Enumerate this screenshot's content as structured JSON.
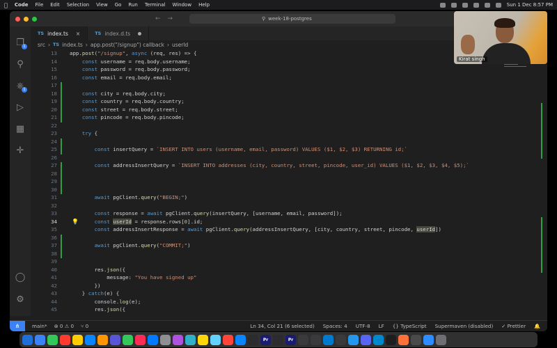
{
  "menubar": {
    "app_name": "Code",
    "items": [
      "File",
      "Edit",
      "Selection",
      "View",
      "Go",
      "Run",
      "Terminal",
      "Window",
      "Help"
    ],
    "datetime": "Sun 1 Dec  8:57 PM"
  },
  "window": {
    "search_text": "week-18-postgres",
    "nav_back": "←",
    "nav_forward": "→"
  },
  "activity": {
    "explorer_badge": "1",
    "scm_badge": "1"
  },
  "tabs": [
    {
      "lang": "TS",
      "label": "index.ts",
      "active": true
    },
    {
      "lang": "TS",
      "label": "index.d.ts",
      "active": false
    }
  ],
  "breadcrumb": [
    "src",
    "TS",
    "index.ts",
    "app.post(\"/signup\") callback",
    "userId"
  ],
  "editor": {
    "lines": [
      {
        "n": "13",
        "t": "app.post(\"/signup\", async (req, res) => {"
      },
      {
        "n": "14",
        "t": "    const username = req.body.username;"
      },
      {
        "n": "15",
        "t": "    const password = req.body.password;"
      },
      {
        "n": "16",
        "t": "    const email = req.body.email;"
      },
      {
        "n": "17",
        "t": ""
      },
      {
        "n": "18",
        "t": "    const city = req.body.city;"
      },
      {
        "n": "19",
        "t": "    const country = req.body.country;"
      },
      {
        "n": "20",
        "t": "    const street = req.body.street;"
      },
      {
        "n": "21",
        "t": "    const pincode = req.body.pincode;"
      },
      {
        "n": "22",
        "t": ""
      },
      {
        "n": "23",
        "t": "    try {"
      },
      {
        "n": "24",
        "t": ""
      },
      {
        "n": "25",
        "t": "        const insertQuery = `INSERT INTO users (username, email, password) VALUES ($1, $2, $3) RETURNING id;`"
      },
      {
        "n": "26",
        "t": ""
      },
      {
        "n": "27",
        "t": "        const addressInsertQuery = `INSERT INTO addresses (city, country, street, pincode, user_id) VALUES ($1, $2, $3, $4, $5);`"
      },
      {
        "n": "28",
        "t": ""
      },
      {
        "n": "29",
        "t": ""
      },
      {
        "n": "30",
        "t": ""
      },
      {
        "n": "31",
        "t": "        await pgClient.query(\"BEGIN;\")"
      },
      {
        "n": "32",
        "t": ""
      },
      {
        "n": "33",
        "t": "        const response = await pgClient.query(insertQuery, [username, email, password]);"
      },
      {
        "n": "34",
        "t": "        const userId = response.rows[0].id;"
      },
      {
        "n": "35",
        "t": "        const addressInsertResponse = await pgClient.query(addressInsertQuery, [city, country, street, pincode, userId])"
      },
      {
        "n": "36",
        "t": ""
      },
      {
        "n": "37",
        "t": "        await pgClient.query(\"COMMIT;\")"
      },
      {
        "n": "38",
        "t": ""
      },
      {
        "n": "39",
        "t": ""
      },
      {
        "n": "40",
        "t": "        res.json({"
      },
      {
        "n": "41",
        "t": "            message: \"You have signed up\""
      },
      {
        "n": "42",
        "t": "        })"
      },
      {
        "n": "43",
        "t": "    } catch(e) {"
      },
      {
        "n": "44",
        "t": "        console.log(e);"
      },
      {
        "n": "45",
        "t": "        res.json({"
      }
    ]
  },
  "status": {
    "branch": "main*",
    "problems": "⊗ 0 ⚠ 0",
    "ports": "⑂ 0",
    "position": "Ln 34, Col 21 (6 selected)",
    "spaces": "Spaces: 4",
    "encoding": "UTF-8",
    "eol": "LF",
    "language": "{} TypeScript",
    "supermaven": "Supermaven (disabled)",
    "prettier": "✓ Prettier"
  },
  "camera": {
    "name": "Kirat singh"
  },
  "dock": {
    "apps": [
      "",
      "",
      "",
      "",
      "",
      "",
      "",
      "",
      "",
      "",
      "",
      "",
      "",
      "",
      "",
      "",
      "",
      "",
      "",
      "Pr",
      "",
      "Pr",
      "",
      "",
      "",
      "",
      "",
      "",
      "",
      "",
      "",
      "",
      "",
      ""
    ]
  }
}
